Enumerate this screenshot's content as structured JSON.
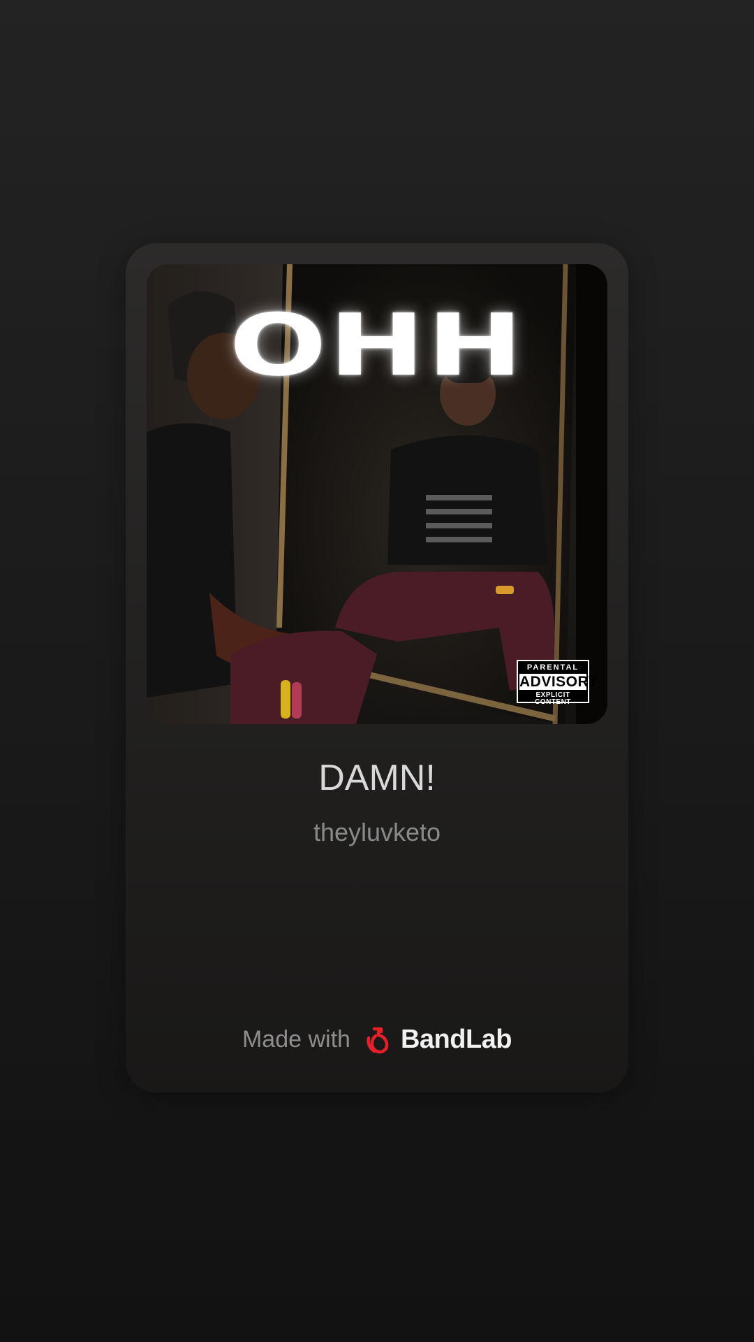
{
  "cover": {
    "title": "OHH",
    "advisory": {
      "line1": "PARENTAL",
      "line2": "ADVISORY",
      "line3": "EXPLICIT CONTENT"
    }
  },
  "track": {
    "title": "DAMN!",
    "artist": "theyluvketo"
  },
  "footer": {
    "made_with": "Made with",
    "brand": "BandLab",
    "brand_icon": "bandlab-logo-icon",
    "brand_color": "#e4202a"
  }
}
